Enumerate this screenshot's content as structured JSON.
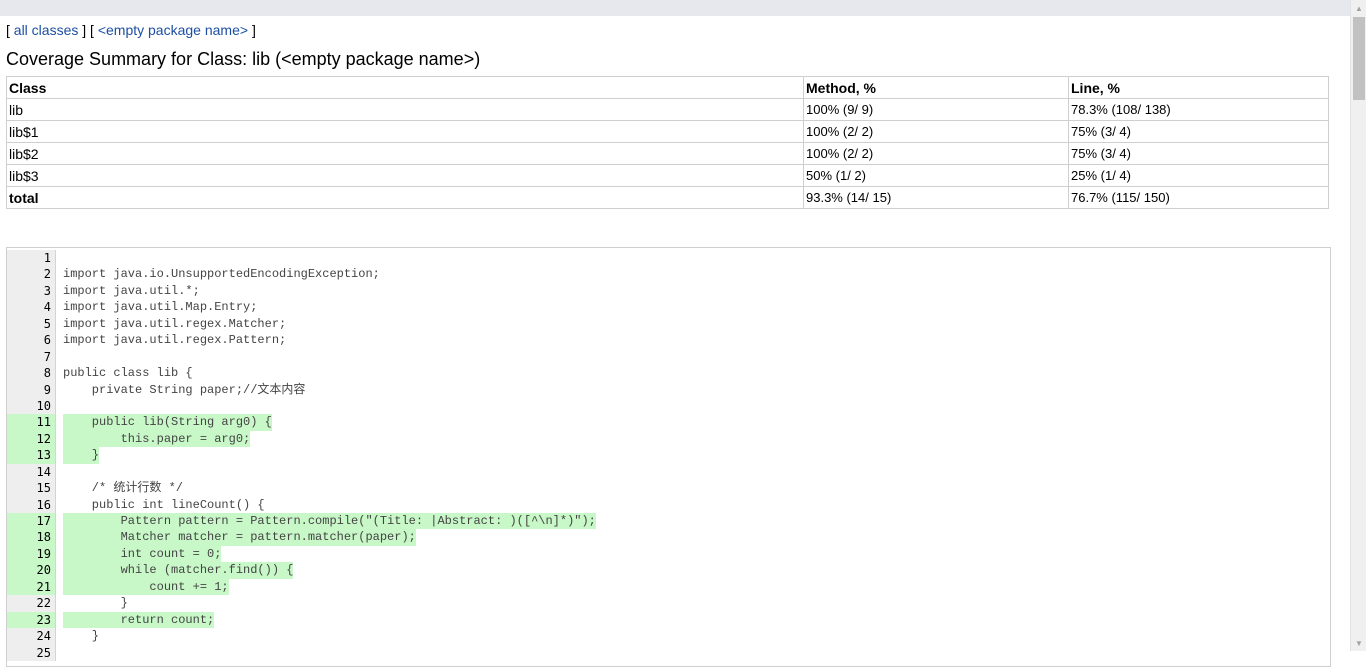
{
  "breadcrumb": {
    "open1": "[",
    "all_classes": "all classes",
    "sep": "] [",
    "package": "<empty package name>",
    "close": "]"
  },
  "title": "Coverage Summary for Class: lib (<empty package name>)",
  "summary": {
    "headers": [
      "Class",
      "Method, %",
      "Line, %"
    ],
    "rows": [
      {
        "cls": "lib",
        "method": "100% (9/ 9)",
        "line": "78.3% (108/ 138)"
      },
      {
        "cls": "lib$1",
        "method": "100% (2/ 2)",
        "line": "75% (3/ 4)"
      },
      {
        "cls": "lib$2",
        "method": "100% (2/ 2)",
        "line": "75% (3/ 4)"
      },
      {
        "cls": "lib$3",
        "method": "50% (1/ 2)",
        "line": "25% (1/ 4)"
      }
    ],
    "total": {
      "cls": "total",
      "method": "93.3% (14/ 15)",
      "line": "76.7% (115/ 150)"
    }
  },
  "source_lines": [
    {
      "n": "1",
      "code": "",
      "covered": false
    },
    {
      "n": "2",
      "code": "import java.io.UnsupportedEncodingException;",
      "covered": false
    },
    {
      "n": "3",
      "code": "import java.util.*;",
      "covered": false
    },
    {
      "n": "4",
      "code": "import java.util.Map.Entry;",
      "covered": false
    },
    {
      "n": "5",
      "code": "import java.util.regex.Matcher;",
      "covered": false
    },
    {
      "n": "6",
      "code": "import java.util.regex.Pattern;",
      "covered": false
    },
    {
      "n": "7",
      "code": "",
      "covered": false
    },
    {
      "n": "8",
      "code": "public class lib {",
      "covered": false
    },
    {
      "n": "9",
      "code": "    private String paper;//文本内容",
      "covered": false
    },
    {
      "n": "10",
      "code": "",
      "covered": false
    },
    {
      "n": "11",
      "code": "    public lib(String arg0) {",
      "covered": true
    },
    {
      "n": "12",
      "code": "        this.paper = arg0;",
      "covered": true
    },
    {
      "n": "13",
      "code": "    }",
      "covered": true
    },
    {
      "n": "14",
      "code": "",
      "covered": false
    },
    {
      "n": "15",
      "code": "    /* 统计行数 */",
      "covered": false
    },
    {
      "n": "16",
      "code": "    public int lineCount() {",
      "covered": false
    },
    {
      "n": "17",
      "code": "        Pattern pattern = Pattern.compile(\"(Title: |Abstract: )([^\\n]*)\");",
      "covered": true
    },
    {
      "n": "18",
      "code": "        Matcher matcher = pattern.matcher(paper);",
      "covered": true
    },
    {
      "n": "19",
      "code": "        int count = 0;",
      "covered": true
    },
    {
      "n": "20",
      "code": "        while (matcher.find()) {",
      "covered": true
    },
    {
      "n": "21",
      "code": "            count += 1;",
      "covered": true
    },
    {
      "n": "22",
      "code": "        }",
      "covered": false
    },
    {
      "n": "23",
      "code": "        return count;",
      "covered": true
    },
    {
      "n": "24",
      "code": "    }",
      "covered": false
    },
    {
      "n": "25",
      "code": "",
      "covered": false
    }
  ],
  "colors": {
    "covered": "#c8f7c8",
    "link": "#1c4fa3",
    "gutter": "#eeeeee"
  }
}
